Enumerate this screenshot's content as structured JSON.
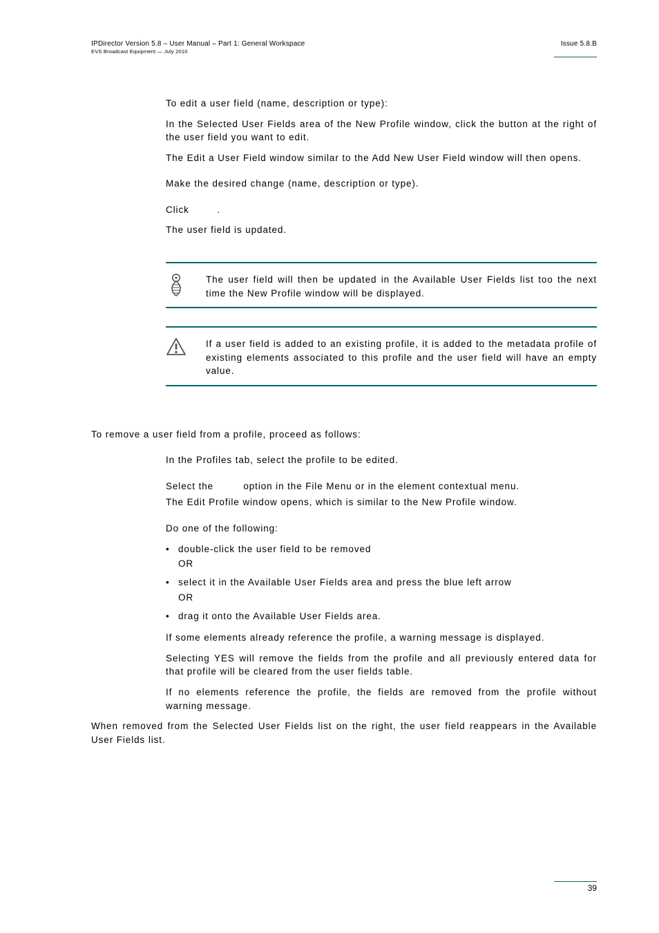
{
  "header": {
    "left_line1": "IPDirector Version 5.8 – User Manual – Part 1: General Workspace",
    "left_line2": "EVS Broadcast Equipment  —  July 2010",
    "right": "Issue 5.8.B"
  },
  "section_edit": {
    "p1": "To edit a user field (name, description or type):",
    "p2": "In the Selected User Fields area of the New Profile window, click the button at the right of the user field you want to edit.",
    "p3": "The Edit a User Field window similar to the Add New User Field window will then opens.",
    "p4": "Make the desired change (name, description or type).",
    "p5_a": "Click ",
    "p5_b": ".",
    "p6": "The user field is updated."
  },
  "note1": {
    "text": "The user field will then be updated in the Available User Fields list too the next time the New Profile window will be displayed.",
    "icon_name": "info-icon"
  },
  "note2": {
    "text": "If a user field is added to an existing profile, it is added to the metadata profile of existing elements associated to this profile and the user field will have an empty value.",
    "icon_name": "warning-icon"
  },
  "section_remove": {
    "intro": "To remove a user field from a profile, proceed as follows:",
    "s1": "In the Profiles tab, select the profile to be edited.",
    "s2_a": "Select the ",
    "s2_b": " option in the File Menu or in the element contextual menu.",
    "s2_c": "The Edit Profile window opens, which is similar to the New Profile window.",
    "s3": "Do one of the following:",
    "b1": "double-click the user field to be removed",
    "or": "OR",
    "b2": "select it in the Available User Fields area and press the blue left arrow",
    "b3": "drag it onto the Available User Fields area.",
    "s4": "If some elements already reference the profile, a warning message is displayed.",
    "s5": "Selecting YES will remove the fields from the profile and all previously entered data for that profile will be cleared from the user fields table.",
    "s6": "If no elements reference the profile, the fields are removed from the profile without warning message.",
    "closing": "When removed from the Selected User Fields list on the right, the user field reappears in the Available User Fields list."
  },
  "footer": {
    "page_no": "39"
  },
  "bullet_glyph": "•"
}
